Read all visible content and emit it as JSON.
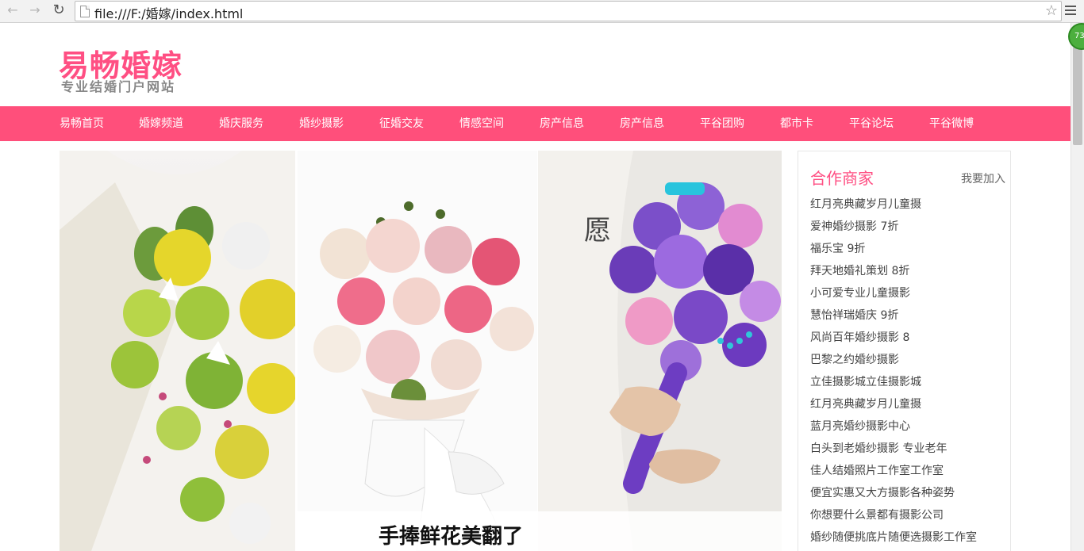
{
  "browser": {
    "url": "file:///F:/婚嫁/index.html",
    "extension_badge": "73"
  },
  "header": {
    "logo_title": "易畅婚嫁",
    "logo_subtitle": "专业结婚门户网站"
  },
  "nav": {
    "items": [
      "易畅首页",
      "婚嫁频道",
      "婚庆服务",
      "婚纱摄影",
      "征婚交友",
      "情感空间",
      "房产信息",
      "房产信息",
      "平谷团购",
      "都市卡",
      "平谷论坛",
      "平谷微博"
    ]
  },
  "banner": {
    "caption": "手捧鲜花美翻了",
    "photo_text": "愿",
    "colors": {
      "nav": "#ff4f7b",
      "accent": "#ff4f83"
    }
  },
  "sidebar": {
    "title": "合作商家",
    "join_link": "我要加入",
    "items": [
      "红月亮典藏岁月儿童摄",
      "爱神婚纱摄影 7折",
      "福乐宝 9折",
      "拜天地婚礼策划 8折",
      "小可爱专业儿童摄影",
      "慧怡祥瑞婚庆 9折",
      "风尚百年婚纱摄影 8",
      "巴黎之约婚纱摄影",
      "立佳摄影城立佳摄影城",
      "红月亮典藏岁月儿童摄",
      "蓝月亮婚纱摄影中心",
      "白头到老婚纱摄影 专业老年",
      "佳人结婚照片工作室工作室",
      "便宜实惠又大方摄影各种姿势",
      "你想要什么景都有摄影公司",
      "婚纱随便挑底片随便选摄影工作室"
    ]
  }
}
